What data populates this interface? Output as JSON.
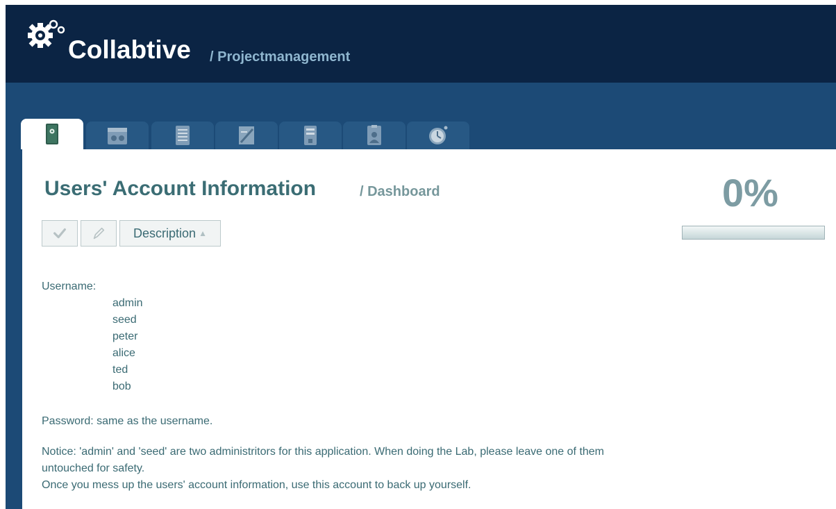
{
  "app": {
    "brand_name": "Collabtive",
    "brand_sub": "/ Projectmanagement"
  },
  "nav": {
    "tabs": [
      {
        "name": "desktop-icon",
        "active": true
      },
      {
        "name": "calendar-icon",
        "active": false
      },
      {
        "name": "tasklist-icon",
        "active": false
      },
      {
        "name": "notes-icon",
        "active": false
      },
      {
        "name": "files-icon",
        "active": false
      },
      {
        "name": "profile-icon",
        "active": false
      },
      {
        "name": "timetracker-icon",
        "active": false
      }
    ]
  },
  "page": {
    "title": "Users' Account Information",
    "subtitle": "/ Dashboard",
    "progress_text": "0%",
    "progress_value": 0
  },
  "toolbar": {
    "complete_icon": "checkmark-icon",
    "edit_icon": "pencil-icon",
    "description_label": "Description",
    "sort_icon": "triangle-up-icon"
  },
  "description": {
    "username_label": "Username:",
    "users": [
      "admin",
      "seed",
      "peter",
      "alice",
      "ted",
      "bob"
    ],
    "password_line": "Password: same as the username.",
    "notice_line1": "Notice: 'admin' and 'seed' are two administritors for this application. When doing the Lab, please leave one of them",
    "notice_line2": "untouched for safety.",
    "notice_line3": "Once you mess up the users' account information, use this account to back up yourself."
  },
  "colors": {
    "header_bg": "#0b2444",
    "tabbar_bg": "#1c4a76",
    "title_color": "#3b6d74",
    "text_color": "#3a6a73"
  }
}
